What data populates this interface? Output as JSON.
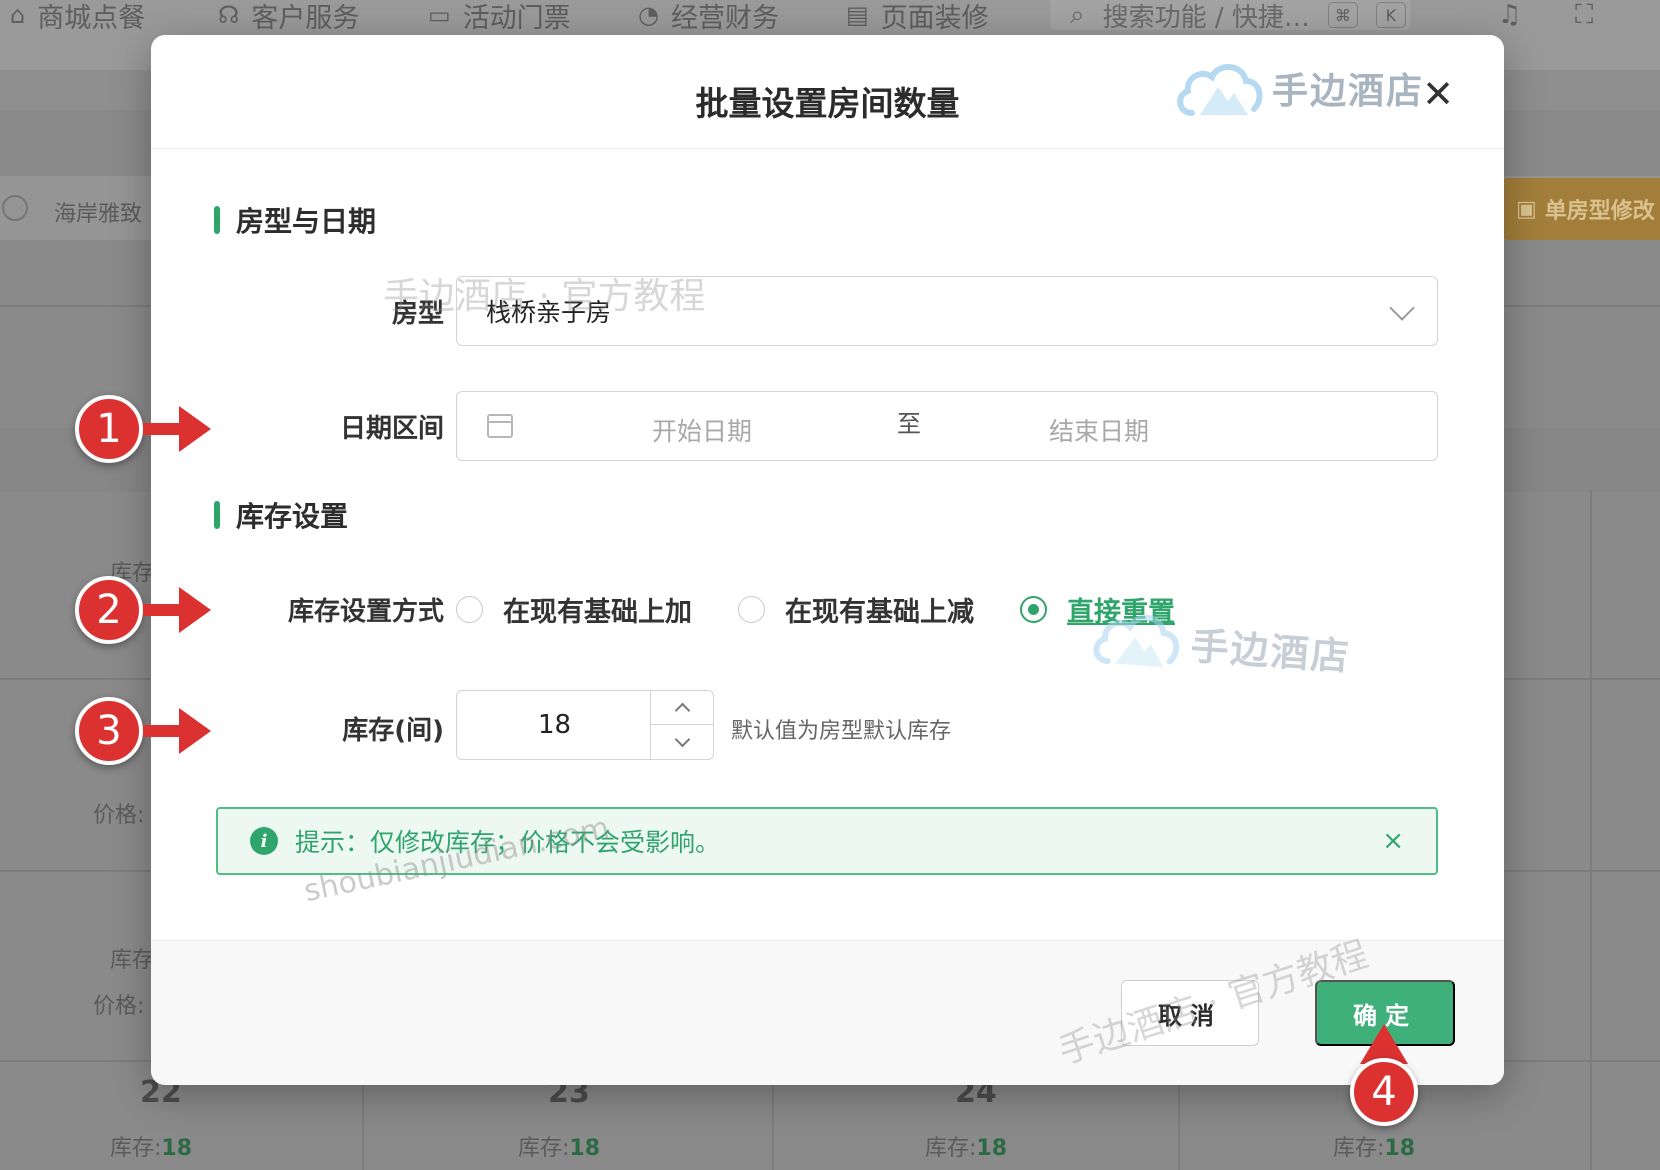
{
  "topnav": {
    "items": [
      {
        "label": "商城点餐",
        "icon": "bag-icon"
      },
      {
        "label": "客户服务",
        "icon": "headset-icon"
      },
      {
        "label": "活动门票",
        "icon": "ticket-icon"
      },
      {
        "label": "经营财务",
        "icon": "chart-icon"
      },
      {
        "label": "页面装修",
        "icon": "paint-icon"
      }
    ],
    "search_placeholder": "搜索功能 / 快捷…",
    "kbd_cmd": "⌘",
    "kbd_k": "K"
  },
  "background": {
    "hotel_name": "海岸雅致",
    "single_edit_label": "单房型修改",
    "row_stock": "库存",
    "row_price": "价格:",
    "calendar": [
      {
        "day": "22",
        "stock_label": "库存:",
        "stock_value": "18"
      },
      {
        "day": "23",
        "stock_label": "库存:",
        "stock_value": "18"
      },
      {
        "day": "24",
        "stock_label": "库存:",
        "stock_value": "18"
      },
      {
        "day": "",
        "stock_label": "库存:",
        "stock_value": "18"
      }
    ]
  },
  "modal": {
    "title": "批量设置房间数量",
    "brand": "手边酒店",
    "close": "✕",
    "section1": "房型与日期",
    "room_type_label": "房型",
    "room_type_value": "栈桥亲子房",
    "date_label": "日期区间",
    "start_placeholder": "开始日期",
    "date_sep": "至",
    "end_placeholder": "结束日期",
    "section2": "库存设置",
    "mode_label": "库存设置方式",
    "modes": [
      {
        "label": "在现有基础上加",
        "checked": false
      },
      {
        "label": "在现有基础上减",
        "checked": false
      },
      {
        "label": "直接重置",
        "checked": true
      }
    ],
    "stock_label": "库存(间)",
    "stock_value": "18",
    "stock_hint": "默认值为房型默认库存",
    "alert_text": "提示：仅修改库存；价格不会受影响。",
    "alert_close": "×",
    "cancel": "取消",
    "ok": "确定"
  },
  "watermarks": {
    "w1": "手边酒店 · 官方教程",
    "w2": "shoubianjiudian.com",
    "w3": "手边酒店 · 官方教程",
    "logo": "手边酒店"
  },
  "markers": [
    "1",
    "2",
    "3",
    "4"
  ],
  "colors": {
    "accent": "#2fa56b",
    "marker": "#dc3131"
  }
}
